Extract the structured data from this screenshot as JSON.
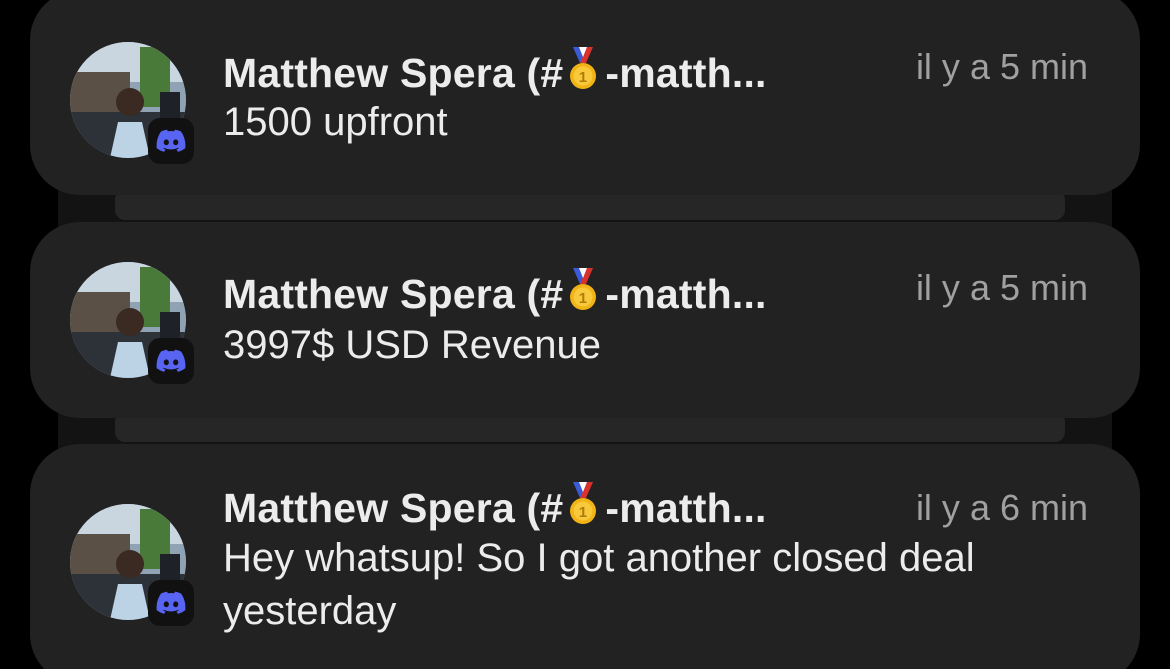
{
  "notifications": [
    {
      "sender_prefix": "Matthew Spera (#",
      "sender_suffix": "-matth...",
      "time": "il y a 5 min",
      "message": "1500 upfront",
      "app_icon": "discord-icon",
      "medal_icon": "gold-medal-icon"
    },
    {
      "sender_prefix": "Matthew Spera (#",
      "sender_suffix": "-matth...",
      "time": "il y a 5 min",
      "message": "3997$ USD Revenue",
      "app_icon": "discord-icon",
      "medal_icon": "gold-medal-icon"
    },
    {
      "sender_prefix": "Matthew Spera (#",
      "sender_suffix": "-matth...",
      "time": "il y a 6 min",
      "message": "Hey whatsup! So I got another closed deal yesterday",
      "app_icon": "discord-icon",
      "medal_icon": "gold-medal-icon"
    }
  ],
  "colors": {
    "card_background": "#222222",
    "discord_blurple": "#5865F2",
    "title_text": "#ececec",
    "time_text": "#a0a0a0"
  }
}
